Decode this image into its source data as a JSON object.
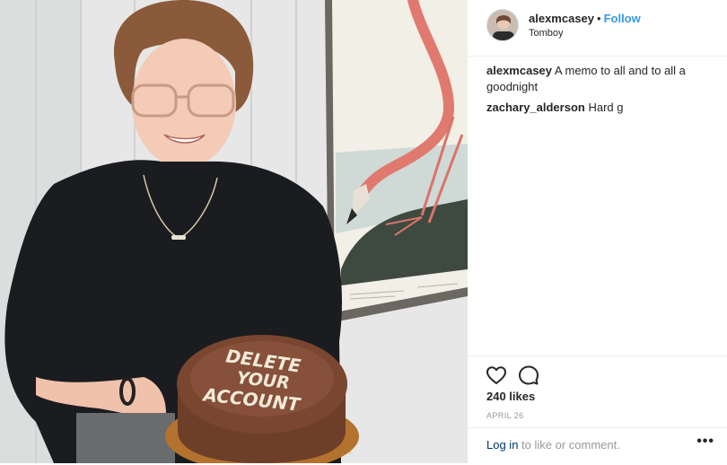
{
  "post": {
    "username": "alexmcasey",
    "separator": "•",
    "follow_label": "Follow",
    "location": "Tomboy",
    "comments": [
      {
        "user": "alexmcasey",
        "text": "A memo to all and to all a goodnight"
      },
      {
        "user": "zachary_alderson",
        "text": "Hard g"
      }
    ],
    "likes": "240 likes",
    "date": "APRIL 26",
    "login_link": "Log in",
    "login_rest": " to like or comment.",
    "more_label": "•••"
  },
  "photo": {
    "cake_text": [
      "DELETE",
      "YOUR",
      "ACCOUNT"
    ]
  },
  "icons": {
    "like": "heart-icon",
    "comment": "comment-icon",
    "more": "more-options-icon"
  },
  "colors": {
    "follow": "#3897f0",
    "login_link": "#003569",
    "muted": "#999999",
    "border": "#efefef"
  }
}
